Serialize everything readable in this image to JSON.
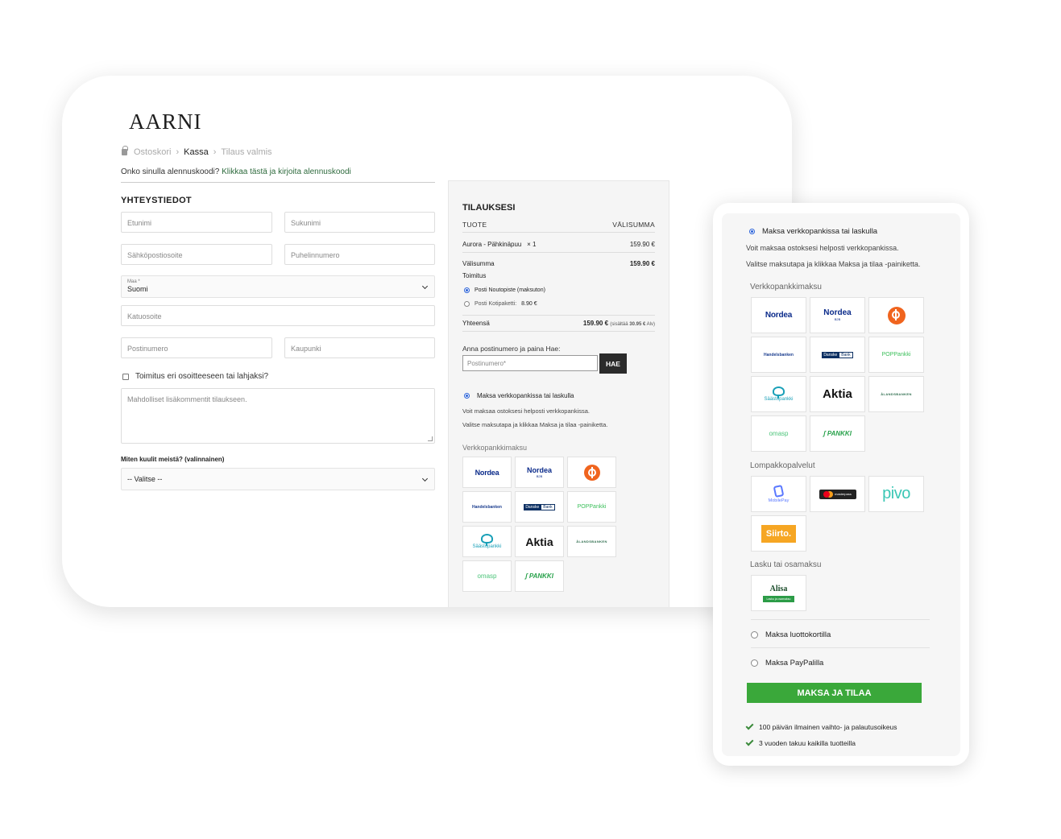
{
  "desktop": {
    "logo": "AARNI",
    "breadcrumb": {
      "step1": "Ostoskori",
      "step2": "Kassa",
      "step3": "Tilaus valmis"
    },
    "coupon": {
      "question": "Onko sinulla alennuskoodi?",
      "link": "Klikkaa tästä ja kirjoita alennuskoodi"
    },
    "contact": {
      "title": "YHTEYSTIEDOT",
      "firstname": "Etunimi",
      "lastname": "Sukunimi",
      "email": "Sähköpostiosoite",
      "phone": "Puhelinnumero",
      "country_label": "Maa *",
      "country_value": "Suomi",
      "street": "Katuosoite",
      "postcode": "Postinumero",
      "city": "Kaupunki",
      "ship_different": "Toimitus eri osoitteeseen tai lahjaksi?",
      "comments": "Mahdolliset lisäkommentit tilaukseen.",
      "hear_label": "Miten kuulit meistä? (valinnainen)",
      "hear_value": "-- Valitse --"
    },
    "order": {
      "title": "TILAUKSESI",
      "col_product": "TUOTE",
      "col_subtotal": "VÄLISUMMA",
      "item_name": "Aurora - Pähkinäpuu",
      "item_qty": "× 1",
      "item_price": "159.90 €",
      "subtotal_label": "Välisumma",
      "subtotal_value": "159.90 €",
      "shipping_label": "Toimitus",
      "ship_option1": "Posti Noutopiste (maksuton)",
      "ship_option2": "Posti Kotipaketti:",
      "ship_option2_price": "8.90 €",
      "total_label": "Yhteensä",
      "total_value": "159.90 €",
      "total_vat_prefix": "(sisältää",
      "total_vat_amount": "30.95 €",
      "total_vat_suffix": "Alv)",
      "postcode_prompt": "Anna postinumero ja paina Hae:",
      "postcode_placeholder": "Postinumero*",
      "search_button": "HAE",
      "pay_option": "Maksa verkkopankissa tai laskulla",
      "pay_text1": "Voit maksaa ostoksesi helposti verkkopankissa.",
      "pay_text2": "Valitse maksutapa ja klikkaa Maksa ja tilaa -painiketta.",
      "bank_group": "Verkkopankkimaksu"
    }
  },
  "mobile": {
    "pay_option": "Maksa verkkopankissa tai laskulla",
    "pay_text1": "Voit maksaa ostoksesi helposti verkkopankissa.",
    "pay_text2": "Valitse maksutapa ja klikkaa Maksa ja tilaa -painiketta.",
    "bank_group": "Verkkopankkimaksu",
    "wallet_group": "Lompakkopalvelut",
    "invoice_group": "Lasku tai osamaksu",
    "card_option": "Maksa luottokortilla",
    "paypal_option": "Maksa PayPalilla",
    "submit": "MAKSA JA TILAA",
    "usp1": "100 päivän ilmainen vaihto- ja palautusoikeus",
    "usp2": "3 vuoden takuu kaikilla tuotteilla"
  },
  "logos": {
    "nordea": "Nordea",
    "nordea_b2b": "B2B",
    "handelsbanken": "Handelsbanken",
    "danske_1": "Danske",
    "danske_2": "Bank",
    "pop": "POPPankki",
    "saastopankki": "Säästöpankki",
    "aktia": "Aktia",
    "alandsbanken": "ÅLANDSBANKEN",
    "omasp": "omasp",
    "spankki": "PANKKI",
    "mobilepay": "MobilePay",
    "masterpass": "masterpass",
    "pivo": "pivo",
    "siirto": "Siirto.",
    "alisa": "Alisa",
    "alisa_bar": "Lasku ja osamaksu"
  }
}
